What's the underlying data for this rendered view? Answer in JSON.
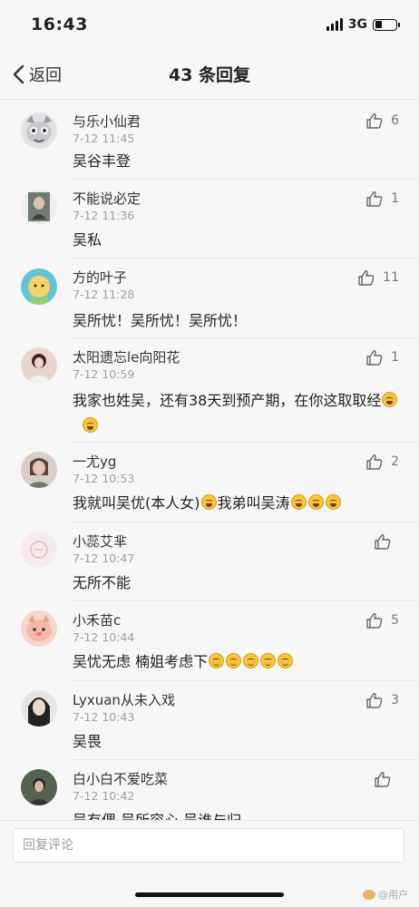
{
  "status_bar": {
    "time": "16:43",
    "network": "3G"
  },
  "nav": {
    "back_label": "返回",
    "title": "43 条回复"
  },
  "replies": [
    {
      "username": "与乐小仙君",
      "time": "7-12 11:45",
      "content": "吴谷丰登",
      "likes": "6",
      "avatar_color": "#d9d6dc"
    },
    {
      "username": "不能说必定",
      "time": "7-12 11:36",
      "content": "吴私",
      "likes": "1",
      "avatar_color": "#7d8a7f"
    },
    {
      "username": "方的叶子",
      "time": "7-12 11:28",
      "content": "吴所忧！吴所忧！吴所忧！",
      "likes": "11",
      "avatar_color": "#6fc9d8"
    },
    {
      "username": "太阳遗忘le向阳花",
      "time": "7-12 10:59",
      "content": "我家也姓吴，还有38天到预产期，在你这取取经",
      "likes": "1",
      "avatar_color": "#c9a49a"
    },
    {
      "username": "一尤yg",
      "time": "7-12 10:53",
      "content": "我就叫吴优(本人女)",
      "content2": "我弟叫吴涛",
      "likes": "2",
      "avatar_color": "#b79a8e"
    },
    {
      "username": "小蕊艾芈",
      "time": "7-12 10:47",
      "content": "无所不能",
      "likes": "",
      "avatar_color": "#f3e4e6"
    },
    {
      "username": "小禾苗c",
      "time": "7-12 10:44",
      "content": "吴忧无虑 楠姐考虑下",
      "likes": "5",
      "avatar_color": "#f0b8a8"
    },
    {
      "username": "Lyxuan从未入戏",
      "time": "7-12 10:43",
      "content": "吴畏",
      "likes": "3",
      "avatar_color": "#4a4a4a"
    },
    {
      "username": "白小白不爱吃菜",
      "time": "7-12 10:42",
      "content": "吴有偶 吴所容心 吴谁与归",
      "likes": "",
      "avatar_color": "#4b5a48"
    }
  ],
  "input": {
    "placeholder": "回复评论"
  },
  "watermark": "@用户"
}
